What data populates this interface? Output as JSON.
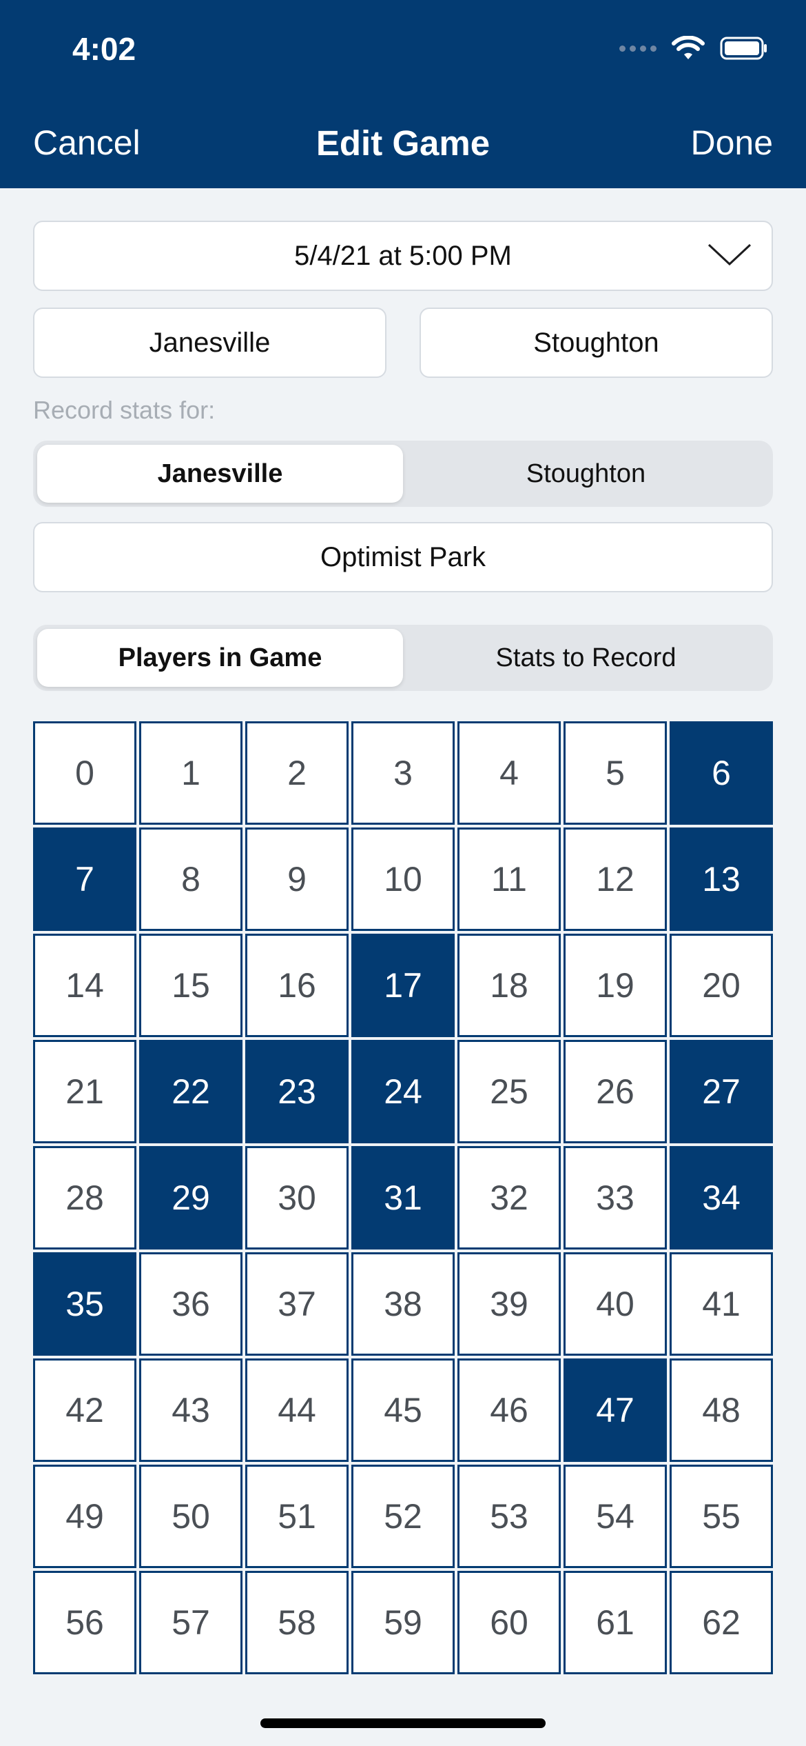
{
  "status": {
    "time": "4:02"
  },
  "nav": {
    "cancel": "Cancel",
    "title": "Edit Game",
    "done": "Done"
  },
  "game": {
    "datetime": "5/4/21 at 5:00 PM",
    "team_left": "Janesville",
    "team_right": "Stoughton",
    "record_label": "Record stats for:",
    "record_options": [
      "Janesville",
      "Stoughton"
    ],
    "record_selected": "Janesville",
    "location": "Optimist Park"
  },
  "mode_tabs": {
    "options": [
      "Players in Game",
      "Stats to Record"
    ],
    "selected": "Players in Game"
  },
  "players": {
    "numbers": [
      "0",
      "1",
      "2",
      "3",
      "4",
      "5",
      "6",
      "7",
      "8",
      "9",
      "10",
      "11",
      "12",
      "13",
      "14",
      "15",
      "16",
      "17",
      "18",
      "19",
      "20",
      "21",
      "22",
      "23",
      "24",
      "25",
      "26",
      "27",
      "28",
      "29",
      "30",
      "31",
      "32",
      "33",
      "34",
      "35",
      "36",
      "37",
      "38",
      "39",
      "40",
      "41",
      "42",
      "43",
      "44",
      "45",
      "46",
      "47",
      "48",
      "49",
      "50",
      "51",
      "52",
      "53",
      "54",
      "55",
      "56",
      "57",
      "58",
      "59",
      "60",
      "61",
      "62"
    ],
    "selected": [
      "6",
      "7",
      "13",
      "17",
      "22",
      "23",
      "24",
      "27",
      "29",
      "31",
      "34",
      "35",
      "47"
    ]
  },
  "colors": {
    "primary": "#033b72",
    "background": "#f0f3f6",
    "muted_text": "#a7adb4"
  }
}
